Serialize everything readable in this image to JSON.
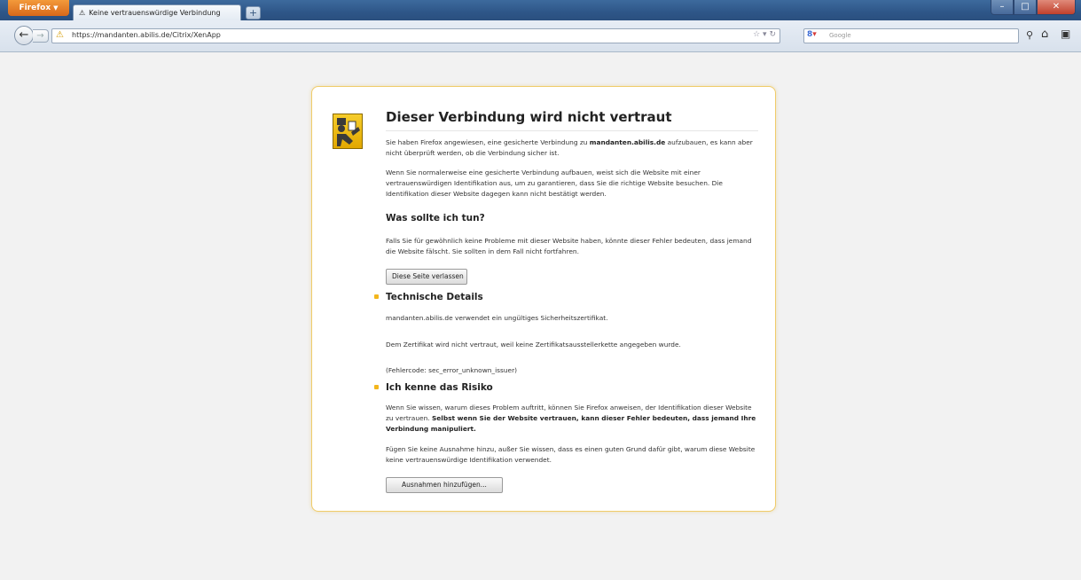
{
  "browser": {
    "app_button": "Firefox",
    "tab_title": "Keine vertrauenswürdige Verbindung",
    "new_tab_symbol": "+",
    "url": "https://mandanten.abilis.de/Citrix/XenApp",
    "search_placeholder": "Google"
  },
  "error": {
    "title": "Dieser Verbindung wird nicht vertraut",
    "intro_before": "Sie haben Firefox angewiesen, eine gesicherte Verbindung zu ",
    "intro_host": "mandanten.abilis.de",
    "intro_after": " aufzubauen, es kann aber nicht überprüft werden, ob die Verbindung sicher ist.",
    "explanation": "Wenn Sie normalerweise eine gesicherte Verbindung aufbauen, weist sich die Website mit einer vertrauenswürdigen Identifikation aus, um zu garantieren, dass Sie die richtige Website besuchen. Die Identifikation dieser Website dagegen kann nicht bestätigt werden.",
    "what_heading": "Was sollte ich tun?",
    "what_text": "Falls Sie für gewöhnlich keine Probleme mit dieser Website haben, könnte dieser Fehler bedeuten, dass jemand die Website fälscht. Sie sollten in dem Fall nicht fortfahren.",
    "leave_button": "Diese Seite verlassen",
    "tech_heading": "Technische Details",
    "tech_line1": "mandanten.abilis.de verwendet ein ungültiges Sicherheitszertifikat.",
    "tech_line2": "Dem Zertifikat wird nicht vertraut, weil keine Zertifikatsausstellerkette angegeben wurde.",
    "tech_code": "(Fehlercode: sec_error_unknown_issuer)",
    "risk_heading": "Ich kenne das Risiko",
    "risk_text_plain": "Wenn Sie wissen, warum dieses Problem auftritt, können Sie Firefox anweisen, der Identifikation dieser Website zu vertrauen. ",
    "risk_text_bold": "Selbst wenn Sie der Website vertrauen, kann dieser Fehler bedeuten, dass jemand Ihre Verbindung manipuliert.",
    "risk_text2": "Fügen Sie keine Ausnahme hinzu, außer Sie wissen, dass es einen guten Grund dafür gibt, warum diese Website keine vertrauenswürdige Identifikation verwendet.",
    "add_exception_button": "Ausnahmen hinzufügen..."
  }
}
